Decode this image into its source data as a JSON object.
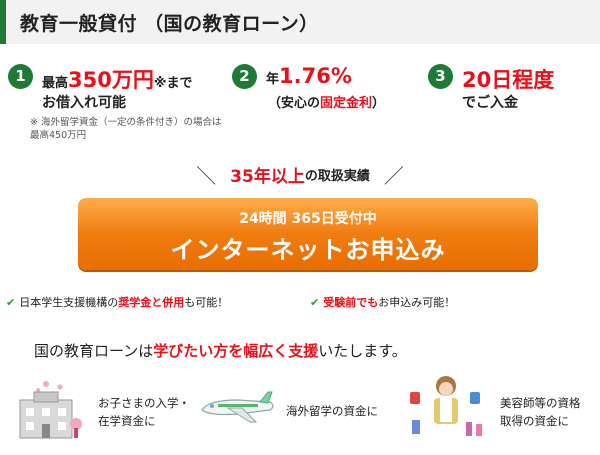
{
  "header": {
    "title": "教育一般貸付 （国の教育ローン）"
  },
  "features": [
    {
      "number": "1",
      "prefix": "最高",
      "highlight": "350万円",
      "suffix": "※まで",
      "line2": "お借入れ可能"
    },
    {
      "number": "2",
      "prefix": "年",
      "highlight": "1.76%",
      "line2_open": "（安心の",
      "line2_em": "固定金利",
      "line2_close": "）"
    },
    {
      "number": "3",
      "highlight": "20日程度",
      "line2": "でご入金"
    }
  ],
  "note": "※ 海外留学資金（一定の条件付き）の場合は最高450万円",
  "achievement": {
    "left_mark": "＼",
    "highlight": "35年以上",
    "suffix": "の取扱実績",
    "right_mark": "／"
  },
  "cta": {
    "sub": "24時間 365日受付中",
    "main": "インターネットお申込み"
  },
  "checks": [
    {
      "before": "日本学生支援機構の",
      "em": "奨学金と併用",
      "after": "も可能！"
    },
    {
      "em": "受験前でも",
      "after": "お申込み可能！"
    }
  ],
  "lead": {
    "a": "国の教育ローンは",
    "em": "学びたい方を幅広く支援",
    "b": "いたします。"
  },
  "uses": [
    {
      "icon": "school-building-icon",
      "line1": "お子さまの入学・",
      "line2": "在学資金に"
    },
    {
      "icon": "airplane-icon",
      "line1": "海外留学の資金に",
      "line2": ""
    },
    {
      "icon": "beautician-icon",
      "line1": "美容師等の資格",
      "line2": "取得の資金に"
    }
  ],
  "colors": {
    "green": "#1e7a34",
    "red": "#e8111b",
    "orange": "#f07c10"
  }
}
